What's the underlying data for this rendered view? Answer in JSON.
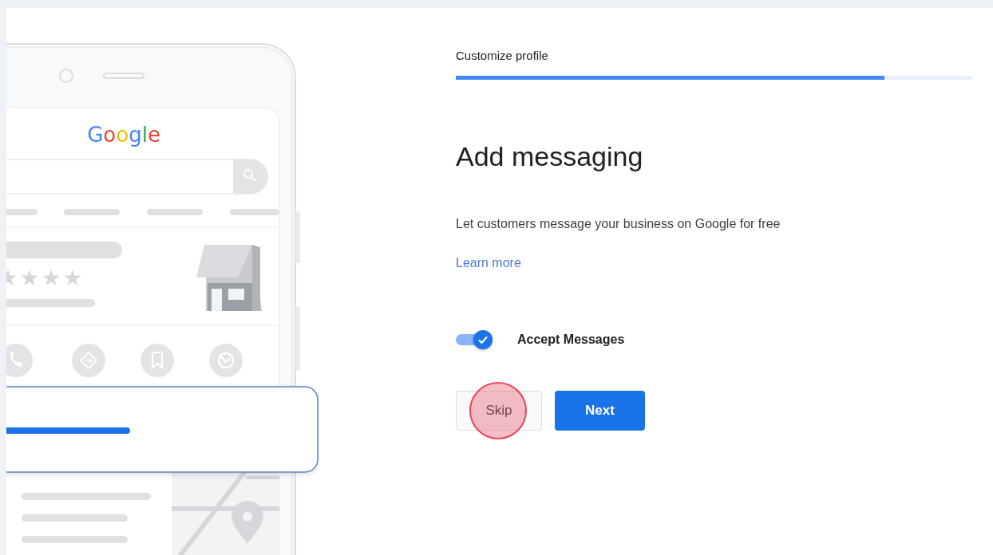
{
  "illustration": {
    "logo_text": "Google"
  },
  "step_title": "Customize profile",
  "progress": {
    "level": 0.83
  },
  "heading": "Add messaging",
  "description": "Let customers message your business on Google for free",
  "link": "Learn more",
  "toggle": {
    "label": "Accept Messages",
    "checked": true
  },
  "buttons": [
    {
      "label": "Skip",
      "kind": "secondary",
      "highlighted": true
    },
    {
      "label": "Next",
      "kind": "primary",
      "highlighted": false
    }
  ]
}
